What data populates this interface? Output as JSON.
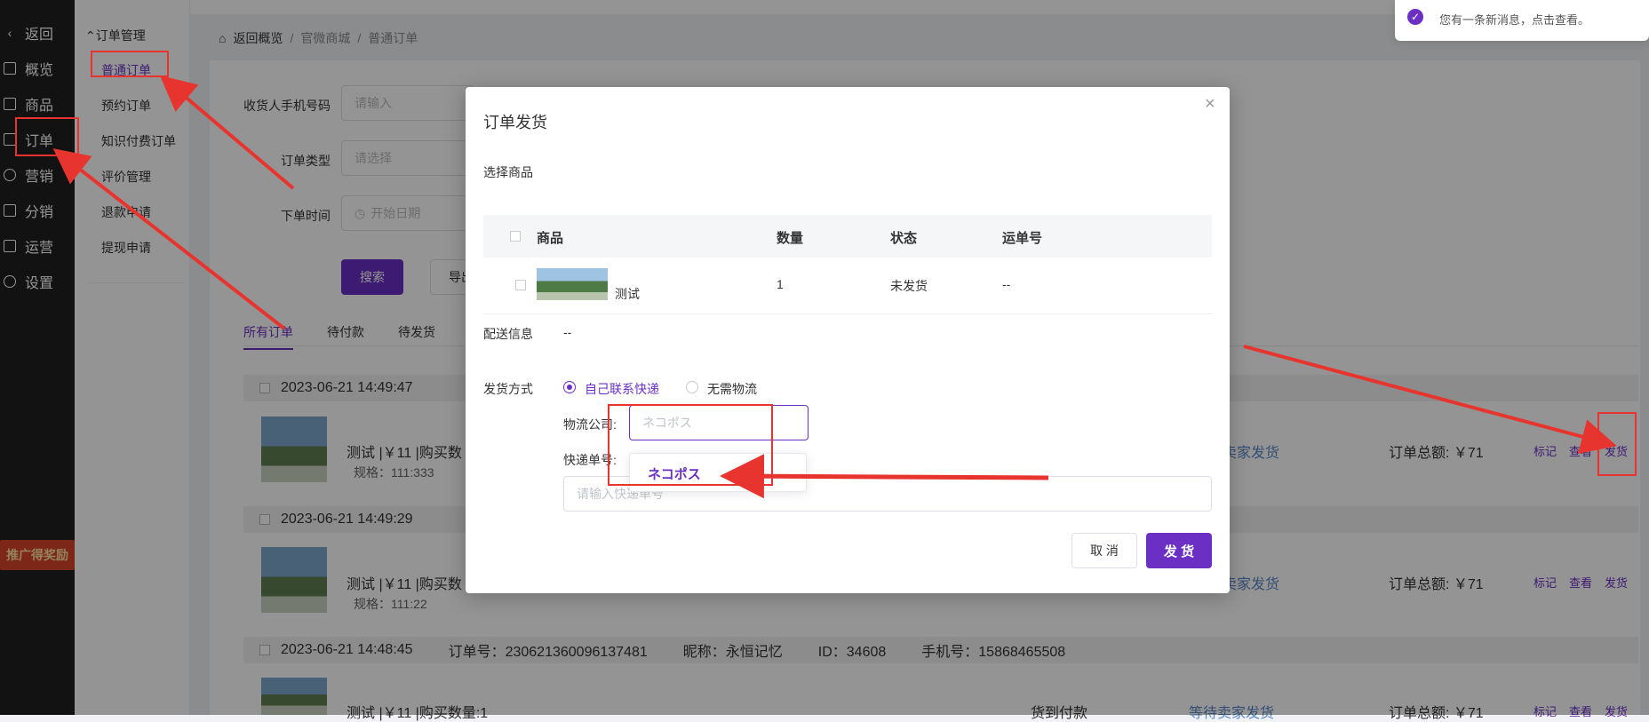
{
  "nav": {
    "items": [
      {
        "label": "返回",
        "icon": "chevron-left-icon"
      },
      {
        "label": "概览",
        "icon": "overview-icon"
      },
      {
        "label": "商品",
        "icon": "goods-icon"
      },
      {
        "label": "订单",
        "icon": "order-icon"
      },
      {
        "label": "营销",
        "icon": "marketing-icon"
      },
      {
        "label": "分销",
        "icon": "distribution-icon"
      },
      {
        "label": "运营",
        "icon": "operation-icon"
      },
      {
        "label": "设置",
        "icon": "settings-icon"
      }
    ],
    "promo": "推广得奖励"
  },
  "submenu": {
    "title": "订单管理",
    "items": [
      "普通订单",
      "预约订单",
      "知识付费订单",
      "评价管理",
      "退款申请",
      "提现申请"
    ]
  },
  "breadcrumb": {
    "home": "返回概览",
    "level1": "官微商城",
    "level2": "普通订单"
  },
  "notification": {
    "message": "您有一条新消息，点击查看。"
  },
  "filters": {
    "phone_label": "收货人手机号码",
    "phone_placeholder": "请输入",
    "type_label": "订单类型",
    "type_placeholder": "请选择",
    "time_label": "下单时间",
    "time_placeholder": "开始日期",
    "search_button": "搜索",
    "export_button": "导出"
  },
  "tabs": [
    "所有订单",
    "待付款",
    "待发货"
  ],
  "orders": [
    {
      "time": "2023-06-21 14:49:47",
      "name": "测试 |￥11 |购买数",
      "spec": "规格：111:333",
      "status": "等待卖家发货",
      "total": "订单总额: ￥71",
      "actions": [
        "标记",
        "查看",
        "发货"
      ]
    },
    {
      "time": "2023-06-21 14:49:29",
      "name": "测试 |￥11 |购买数",
      "spec": "规格：111:22",
      "status": "等待卖家发货",
      "total": "订单总额: ￥71",
      "actions": [
        "标记",
        "查看",
        "发货"
      ]
    },
    {
      "time": "2023-06-21 14:48:45",
      "order_no": "订单号：230621360096137481",
      "nickname": "昵称：永恒记忆",
      "id": "ID：34608",
      "phone": "手机号：15868465508",
      "name": "测试 |￥11 |购买数量:1",
      "cash": "货到付款",
      "status": "等待卖家发货",
      "total": "订单总额: ￥71",
      "actions": [
        "标记",
        "查看",
        "发货"
      ]
    }
  ],
  "modal": {
    "title": "订单发货",
    "select_goods": "选择商品",
    "columns": [
      "商品",
      "数量",
      "状态",
      "运单号"
    ],
    "row": {
      "name": "测试",
      "qty": "1",
      "status": "未发货",
      "tracking": "--"
    },
    "delivery_label": "配送信息",
    "delivery_value": "--",
    "method_label": "发货方式",
    "method_options": [
      "自己联系快递",
      "无需物流"
    ],
    "company_label": "物流公司:",
    "company_value": "ネコポス",
    "tracking_label": "快递单号:",
    "tracking_placeholder": "请输入快递单号",
    "dropdown_option": "ネコポス",
    "cancel_button": "取 消",
    "ship_button": "发 货"
  },
  "colors": {
    "accent": "#6b2fc4",
    "annotation": "#e8342e",
    "nav_bg": "#1f1f1f"
  }
}
